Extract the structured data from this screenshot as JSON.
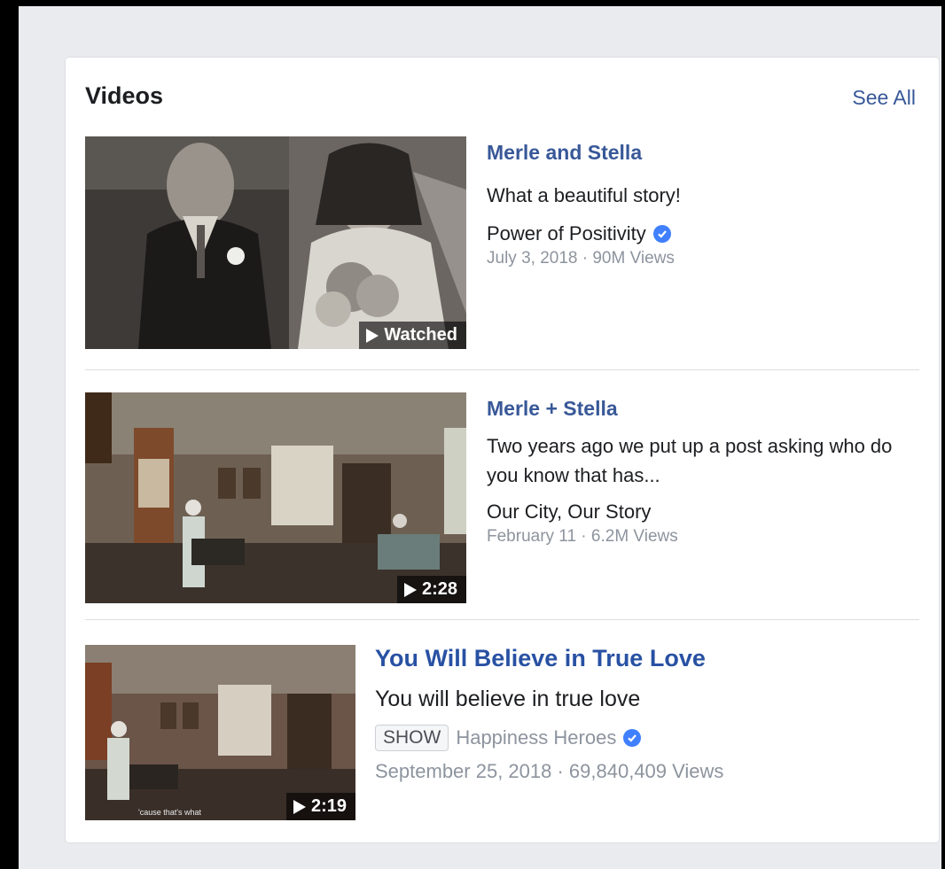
{
  "section": {
    "title": "Videos",
    "see_all_label": "See All"
  },
  "videos": [
    {
      "title": "Merle and Stella",
      "description": "What a beautiful story!",
      "source": "Power of Positivity",
      "verified": true,
      "meta": "July 3, 2018 · 90M Views",
      "badge": "Watched"
    },
    {
      "title": "Merle + Stella",
      "description": "Two years ago we put up a post asking who do you know that has...",
      "source": "Our City, Our Story",
      "verified": false,
      "meta": "February 11 · 6.2M Views",
      "badge": "2:28"
    },
    {
      "title": "You Will Believe in True Love",
      "description": "You will believe in true love",
      "tag": "SHOW",
      "source": "Happiness Heroes",
      "verified": true,
      "meta": "September 25, 2018 · 69,840,409 Views",
      "badge": "2:19"
    }
  ],
  "colors": {
    "link": "#385898",
    "verified": "#4080ff",
    "muted": "#8d949e",
    "page_bg": "#e9ebee"
  },
  "icons": [
    "play-icon",
    "verified-badge-icon"
  ]
}
